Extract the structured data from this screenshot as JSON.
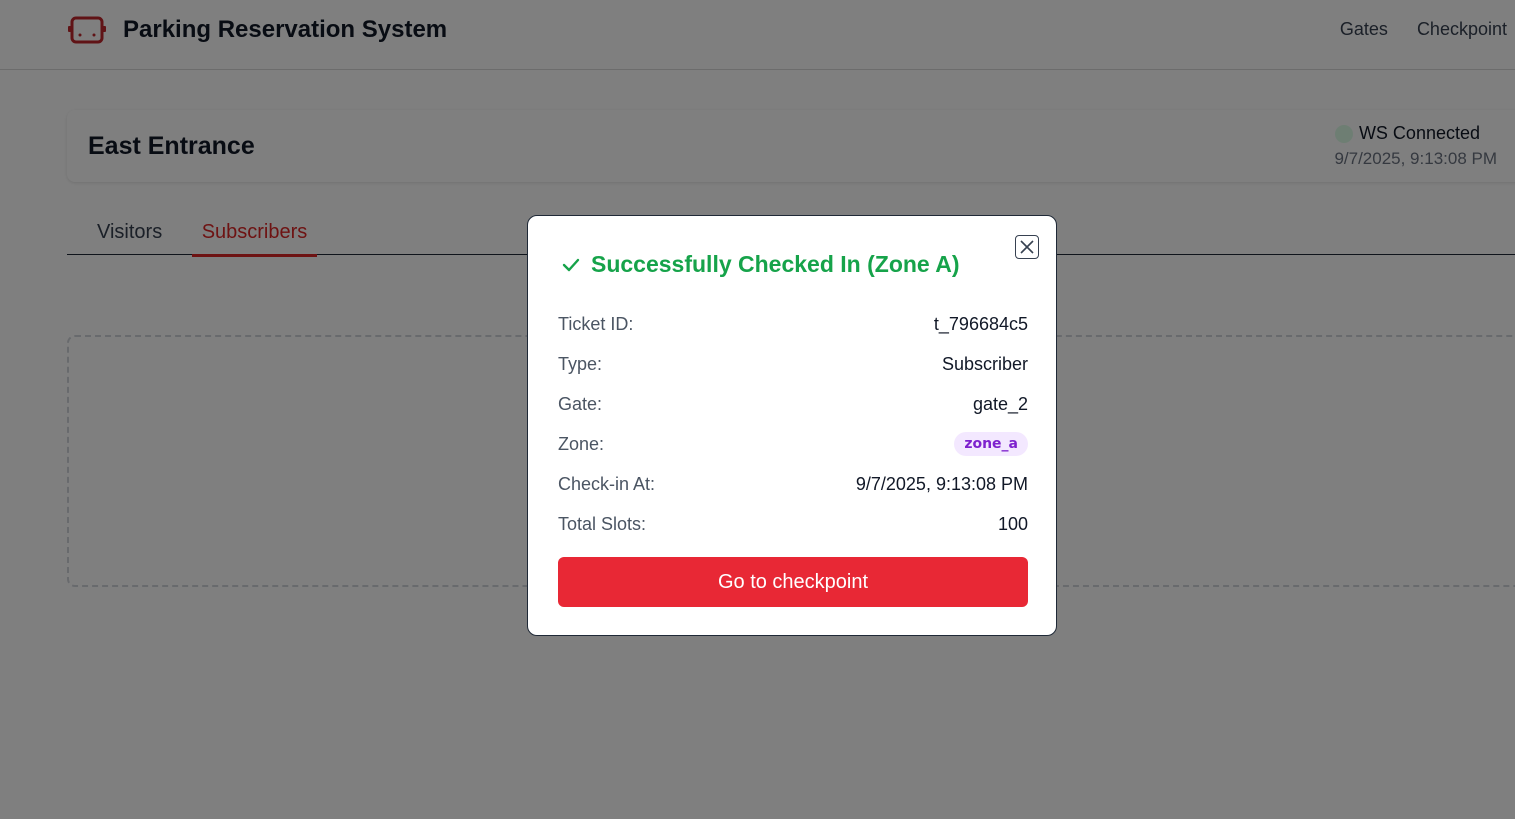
{
  "header": {
    "app_title": "Parking Reservation System",
    "logo_icon": "car-icon",
    "nav": [
      {
        "label": "Gates"
      },
      {
        "label": "Checkpoint"
      }
    ]
  },
  "gate": {
    "name": "East Entrance",
    "ws_status": "WS Connected",
    "ws_status_color": "#dcfce7",
    "time": "9/7/2025, 9:13:08 PM"
  },
  "tabs": [
    {
      "label": "Visitors",
      "active": false
    },
    {
      "label": "Subscribers",
      "active": true
    }
  ],
  "colors": {
    "accent": "#dc2626",
    "success": "#16a34a",
    "button": "#e82835",
    "zone_badge_bg": "#f3e8ff",
    "zone_badge_fg": "#7e22ce"
  },
  "modal": {
    "title": "Successfully Checked In (Zone A)",
    "title_icon": "check-icon",
    "close_icon": "close-icon",
    "rows": [
      {
        "label": "Ticket ID:",
        "value": "t_796684c5"
      },
      {
        "label": "Type:",
        "value": "Subscriber"
      },
      {
        "label": "Gate:",
        "value": "gate_2"
      },
      {
        "label": "Zone:",
        "value": "zone_a"
      },
      {
        "label": "Check-in At:",
        "value": "9/7/2025, 9:13:08 PM"
      },
      {
        "label": "Total Slots:",
        "value": "100"
      }
    ],
    "button_label": "Go to checkpoint"
  }
}
